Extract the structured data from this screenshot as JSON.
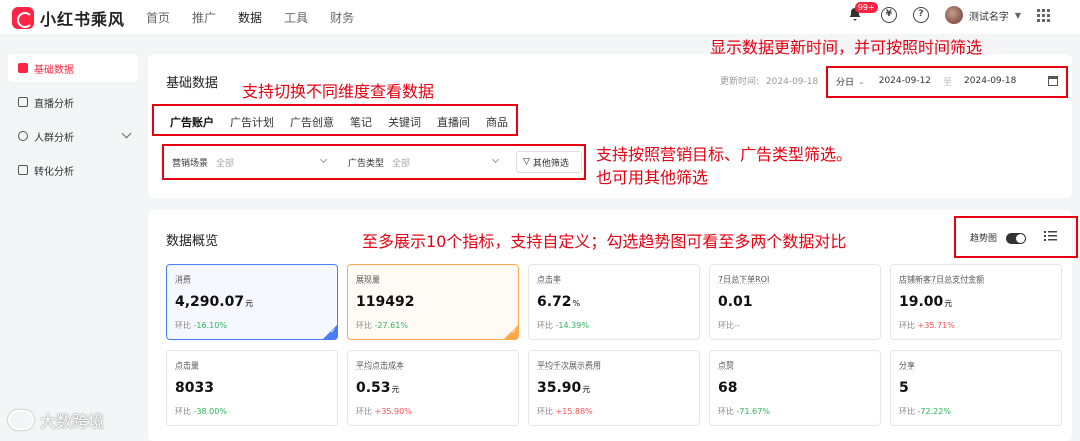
{
  "app": {
    "name": "小红书乘风"
  },
  "topnav": [
    "首页",
    "推广",
    "数据",
    "工具",
    "财务"
  ],
  "header": {
    "badge": "99+",
    "user_name": "测试名字"
  },
  "sidebar": {
    "items": [
      {
        "label": "基础数据"
      },
      {
        "label": "直播分析"
      },
      {
        "label": "人群分析"
      },
      {
        "label": "转化分析"
      }
    ]
  },
  "basic": {
    "title": "基础数据",
    "update_label": "更新时间:",
    "update_time": "2024-09-18",
    "granularity": "分日",
    "date_start": "2024-09-12",
    "date_sep": "至",
    "date_end": "2024-09-18",
    "tabs": [
      "广告账户",
      "广告计划",
      "广告创意",
      "笔记",
      "关键词",
      "直播间",
      "商品"
    ],
    "filter1_label": "营销场景",
    "filter1_value": "全部",
    "filter2_label": "广告类型",
    "filter2_value": "全部",
    "more_filter": "其他筛选"
  },
  "overview": {
    "title": "数据概览",
    "trend_label": "趋势图"
  },
  "metrics": [
    {
      "name": "消费",
      "value": "4,290.07",
      "unit": "元",
      "cmp_label": "环比",
      "cmp": "-16.10%",
      "dir": "down"
    },
    {
      "name": "展现量",
      "value": "119492",
      "unit": "",
      "cmp_label": "环比",
      "cmp": "-27.61%",
      "dir": "down"
    },
    {
      "name": "点击率",
      "value": "6.72",
      "unit": "%",
      "cmp_label": "环比",
      "cmp": "-14.39%",
      "dir": "down"
    },
    {
      "name": "7日总下单ROI",
      "value": "0.01",
      "unit": "",
      "cmp_label": "环比",
      "cmp": "--",
      "dir": "none"
    },
    {
      "name": "店铺新客7日总支付金额",
      "value": "19.00",
      "unit": "元",
      "cmp_label": "环比",
      "cmp": "+35.71%",
      "dir": "up"
    },
    {
      "name": "点击量",
      "value": "8033",
      "unit": "",
      "cmp_label": "环比",
      "cmp": "-38.00%",
      "dir": "down"
    },
    {
      "name": "平均点击成本",
      "value": "0.53",
      "unit": "元",
      "cmp_label": "环比",
      "cmp": "+35.90%",
      "dir": "up"
    },
    {
      "name": "平均千次展示费用",
      "value": "35.90",
      "unit": "元",
      "cmp_label": "环比",
      "cmp": "+15.88%",
      "dir": "up"
    },
    {
      "name": "点赞",
      "value": "68",
      "unit": "",
      "cmp_label": "环比",
      "cmp": "-71.67%",
      "dir": "down"
    },
    {
      "name": "分享",
      "value": "5",
      "unit": "",
      "cmp_label": "环比",
      "cmp": "-72.22%",
      "dir": "down"
    }
  ],
  "annotations": {
    "a1": "显示数据更新时间，并可按照时间筛选",
    "a2": "支持切换不同维度查看数据",
    "a3_line1": "支持按照营销目标、广告类型筛选。",
    "a3_line2": "也可用其他筛选",
    "a4": "至多展示10个指标，支持自定义；勾选趋势图可看至多两个数据对比"
  },
  "watermark": "大数跨境",
  "colors": {
    "brand": "#ff2442",
    "annotation": "#e60012",
    "down": "#2db55d",
    "up": "#ff4d4f"
  }
}
